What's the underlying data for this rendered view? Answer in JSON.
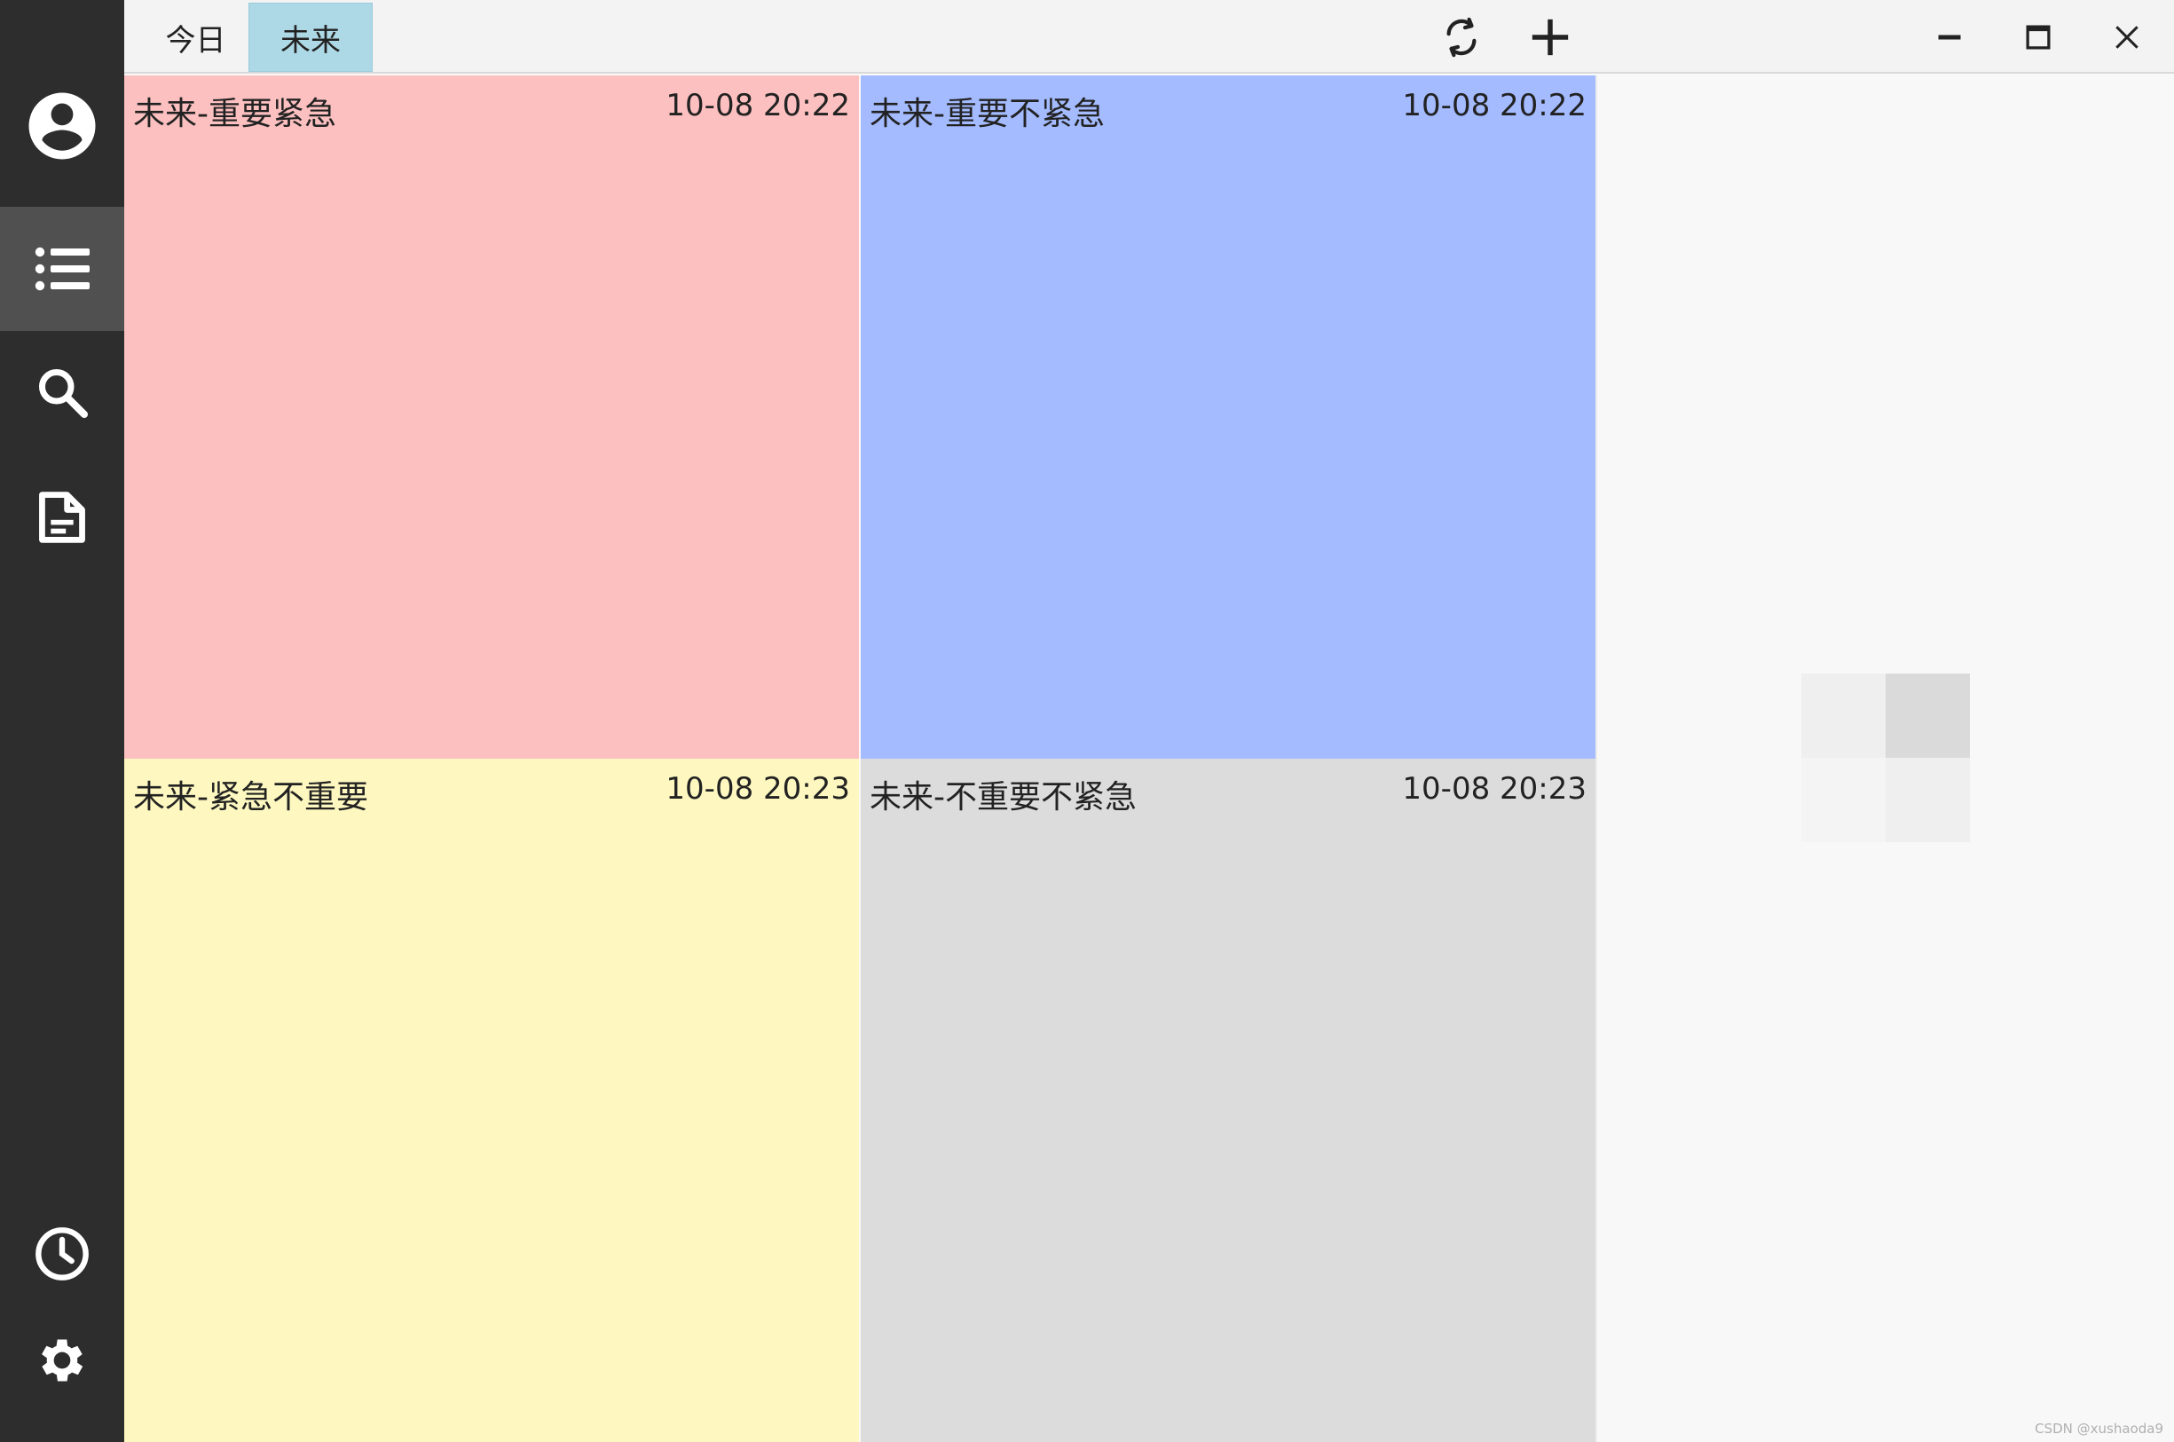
{
  "tabs": [
    {
      "label": "今日",
      "active": false
    },
    {
      "label": "未来",
      "active": true
    }
  ],
  "sidebar": {
    "items": [
      {
        "icon": "account-icon",
        "active": false
      },
      {
        "icon": "list-icon",
        "active": true
      },
      {
        "icon": "search-icon",
        "active": false
      },
      {
        "icon": "document-icon",
        "active": false
      },
      {
        "icon": "clock-icon",
        "active": false
      },
      {
        "icon": "gear-icon",
        "active": false
      }
    ]
  },
  "toolbar": {
    "icons": [
      "refresh-icon",
      "add-icon",
      "minimize-icon",
      "maximize-icon",
      "close-icon"
    ]
  },
  "quadrants": [
    {
      "title": "未来-重要紧急",
      "time": "10-08 20:22",
      "color": "#fdc0c0"
    },
    {
      "title": "未来-重要不紧急",
      "time": "10-08 20:22",
      "color": "#a4bbff"
    },
    {
      "title": "未来-紧急不重要",
      "time": "10-08 20:23",
      "color": "#fef8c0"
    },
    {
      "title": "未来-不重要不紧急",
      "time": "10-08 20:23",
      "color": "#dcdcdc"
    }
  ],
  "watermark": "CSDN @xushaoda9"
}
